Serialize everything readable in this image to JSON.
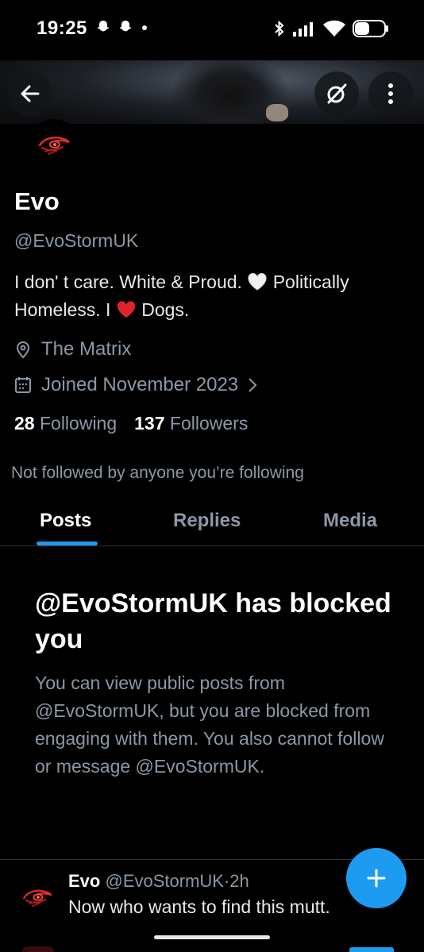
{
  "status_bar": {
    "time": "19:25"
  },
  "profile": {
    "name": "Evo",
    "handle": "@EvoStormUK",
    "bio_part1": "I don' t care. White & Proud. ",
    "bio_part2": " Politically Homeless.  I ",
    "bio_part3": " Dogs.",
    "location": "The Matrix",
    "joined": "Joined November 2023",
    "following_count": "28",
    "following_label": "Following",
    "followers_count": "137",
    "followers_label": "Followers",
    "not_followed": "Not followed by anyone you’re following"
  },
  "tabs": [
    {
      "label": "Posts",
      "active": true
    },
    {
      "label": "Replies",
      "active": false
    },
    {
      "label": "Media",
      "active": false
    }
  ],
  "blocked": {
    "title": "@EvoStormUK has blocked you",
    "body": "You can view public posts from @EvoStormUK, but you are blocked from engaging with them. You also cannot follow or message @EvoStormUK."
  },
  "post": {
    "name": "Evo",
    "handle": "@EvoStormUK",
    "separator": "·",
    "time": "2h",
    "text": "Now who wants to find this mutt."
  },
  "colors": {
    "accent": "#1d9bf0",
    "background": "#000000",
    "secondary_text": "#8b98a5",
    "divider": "#2f3336"
  }
}
